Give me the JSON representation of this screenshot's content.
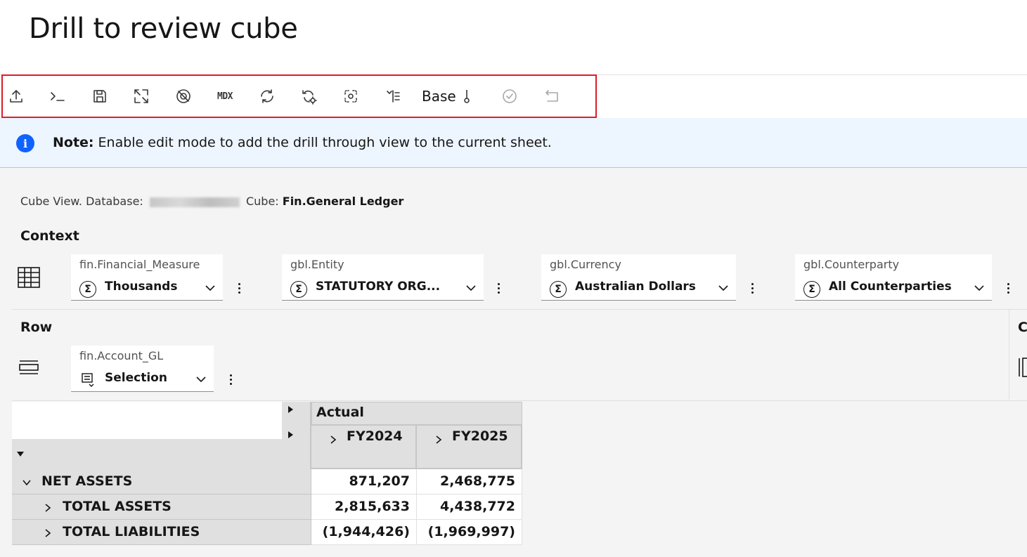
{
  "page": {
    "title": "Drill to review cube"
  },
  "toolbar": {
    "items": [
      {
        "name": "export-icon"
      },
      {
        "name": "terminal-icon"
      },
      {
        "name": "save-icon"
      },
      {
        "name": "expand-icon"
      },
      {
        "name": "hide-icon"
      },
      {
        "name": "mdx-icon",
        "label": "MDX"
      },
      {
        "name": "refresh-icon"
      },
      {
        "name": "auto-refresh-icon"
      },
      {
        "name": "focus-icon"
      },
      {
        "name": "indent-icon"
      },
      {
        "name": "base-button",
        "label": "Base"
      },
      {
        "name": "commit-icon",
        "disabled": true
      },
      {
        "name": "undo-icon",
        "disabled": true
      }
    ]
  },
  "note": {
    "icon": "information-icon",
    "prefix": "Note:",
    "text": "Enable edit mode to add the drill through view to the current sheet."
  },
  "cube_view": {
    "prefix": "Cube View. Database: ",
    "cube_prefix": " Cube: ",
    "cube_name": "Fin.General Ledger"
  },
  "context": {
    "label": "Context",
    "dimensions": [
      {
        "label": "fin.Financial_Measure",
        "value": "Thousands"
      },
      {
        "label": "gbl.Entity",
        "value": "STATUTORY ORG..."
      },
      {
        "label": "gbl.Currency",
        "value": "Australian Dollars"
      },
      {
        "label": "gbl.Counterparty",
        "value": "All Counterparties"
      }
    ]
  },
  "row": {
    "label": "Row",
    "dimension": {
      "label": "fin.Account_GL",
      "value": "Selection"
    }
  },
  "column": {
    "label": "C"
  },
  "grid": {
    "header": "Actual",
    "columns": [
      "FY2024",
      "FY2025"
    ],
    "rows": [
      {
        "label": "NET ASSETS",
        "expanded": true,
        "values": [
          "871,207",
          "2,468,775"
        ]
      },
      {
        "label": "TOTAL ASSETS",
        "expanded": false,
        "values": [
          "2,815,633",
          "4,438,772"
        ]
      },
      {
        "label": "TOTAL LIABILITIES",
        "expanded": false,
        "values": [
          "(1,944,426)",
          "(1,969,997)"
        ]
      }
    ]
  }
}
